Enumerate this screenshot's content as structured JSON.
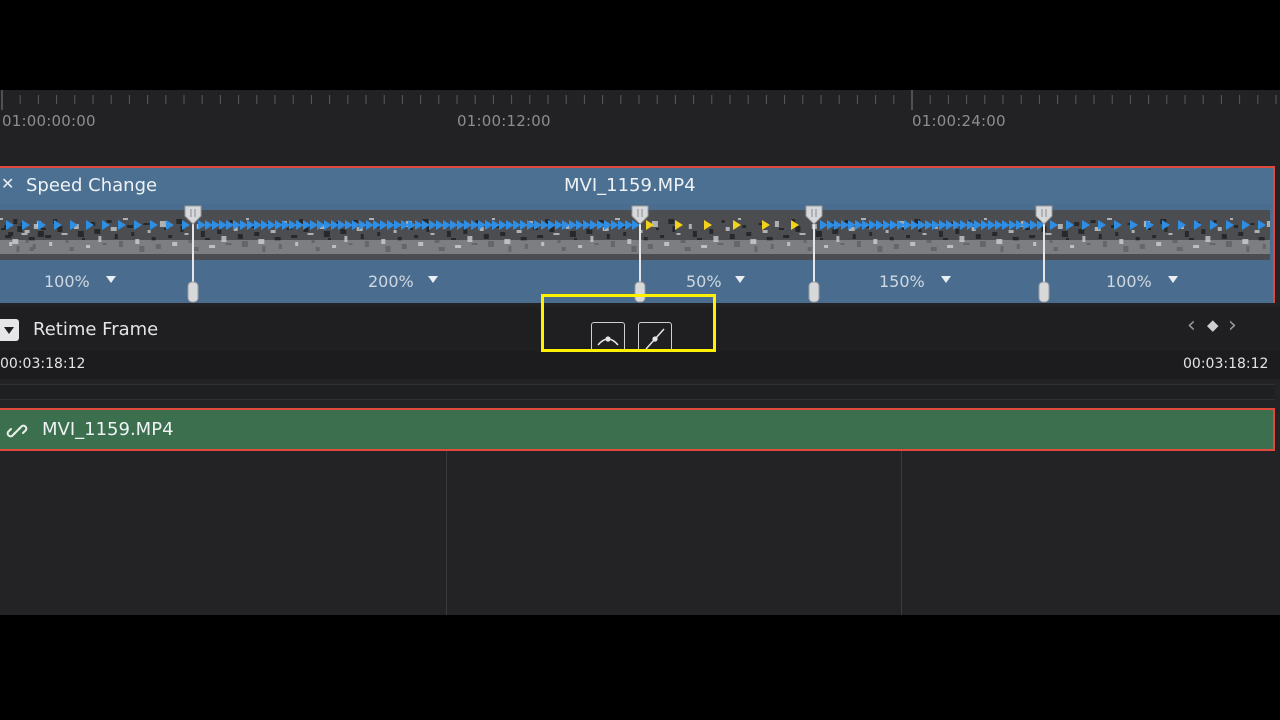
{
  "ruler": {
    "timecodes": [
      "01:00:00:00",
      "01:00:12:00",
      "01:00:24:00"
    ]
  },
  "clip": {
    "close_glyph": "✕",
    "speed_change_label": "Speed Change",
    "name": "MVI_1159.MP4",
    "segments": [
      {
        "speed": "100%"
      },
      {
        "speed": "200%"
      },
      {
        "speed": "50%"
      },
      {
        "speed": "150%"
      },
      {
        "speed": "100%"
      }
    ]
  },
  "retime": {
    "title": "Retime Frame",
    "tc_left": "00:03:18:12",
    "tc_right": "00:03:18:12",
    "nav_prev": "‹",
    "nav_key": "◆",
    "nav_next": "›"
  },
  "audio": {
    "link_icon": "link-icon",
    "name": "MVI_1159.MP4"
  },
  "colors": {
    "clip_blue": "#4a6d8f",
    "selection_red": "#e04a3c",
    "highlight_yellow": "#fff000",
    "audio_green": "#3b6f4e",
    "speed_arrow_blue": "#2f8de4",
    "speed_arrow_yellow": "#f2d21a"
  }
}
